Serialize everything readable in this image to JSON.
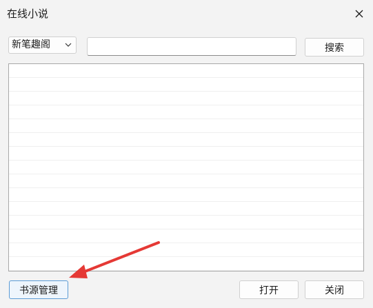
{
  "window": {
    "title": "在线小说"
  },
  "toolbar": {
    "source_select": {
      "selected": "新笔趣阁"
    },
    "search_input": {
      "value": "",
      "placeholder": ""
    },
    "search_label": "搜索"
  },
  "results": {
    "rows": [
      "",
      "",
      "",
      "",
      "",
      "",
      "",
      "",
      "",
      "",
      "",
      "",
      "",
      "",
      ""
    ]
  },
  "footer": {
    "source_manage_label": "书源管理",
    "open_label": "打开",
    "close_label": "关闭"
  },
  "annotation": {
    "arrow_color": "#e53935",
    "arrow_target": "source-manage-button"
  },
  "icons": {
    "close": "close-icon",
    "dropdown": "chevron-down-icon"
  }
}
